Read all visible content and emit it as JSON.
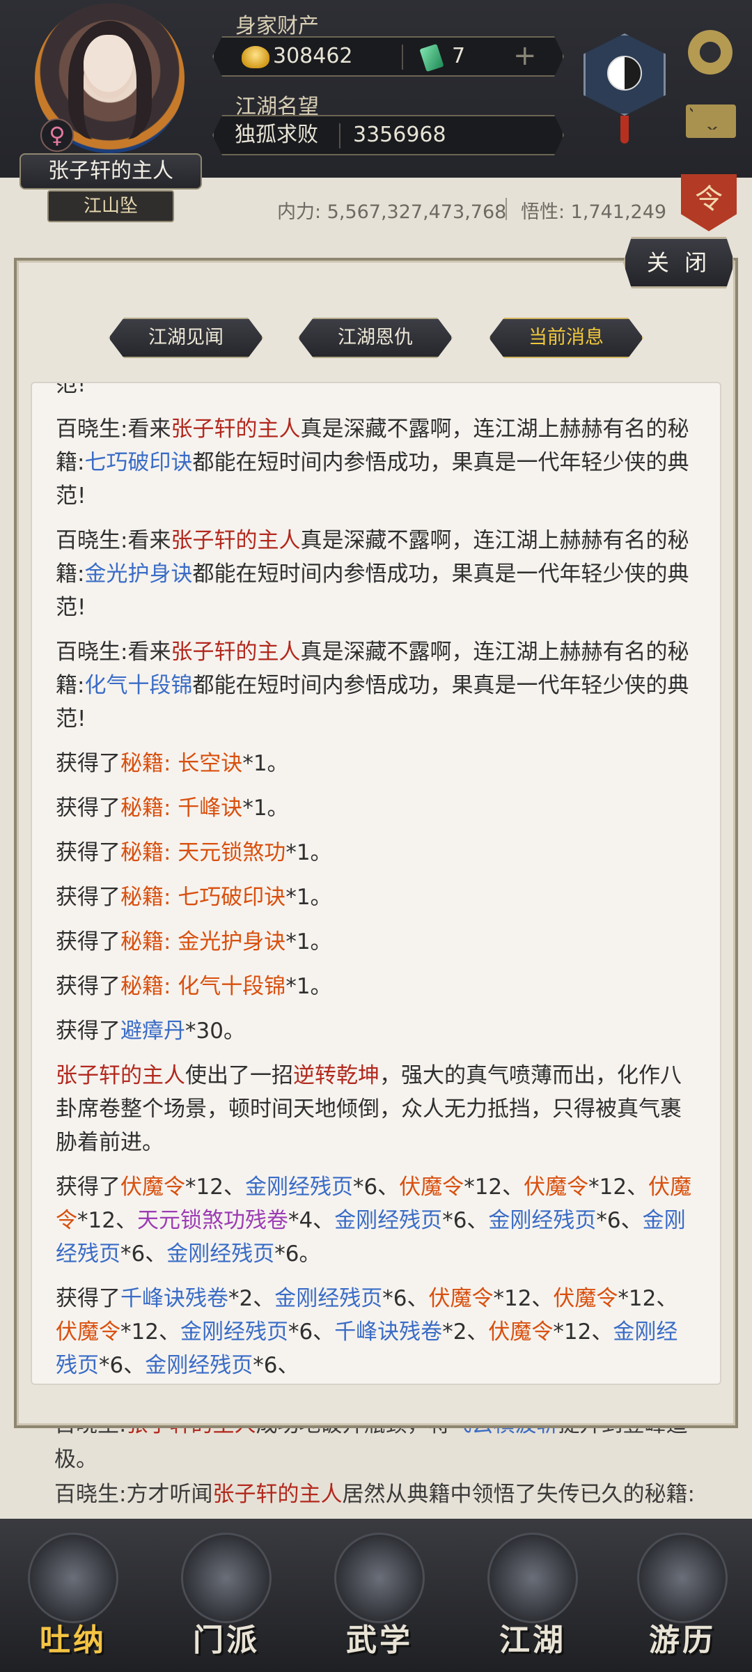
{
  "header": {
    "wealth_label": "身家财产",
    "silver": "308462",
    "jade": "7",
    "reputation_label": "江湖名望",
    "rank": "独孤求败",
    "reputation": "3356968",
    "gender_symbol": "♀",
    "player_name": "张子轩的主人",
    "title": "江山坠",
    "stats_neili": "内力: 5,567,327,473,768",
    "stats_wuxing": "悟性: 1,741,249",
    "order_badge": "令",
    "icons": [
      "coin-icon",
      "jade-icon",
      "plus-icon",
      "taiji-icon",
      "gear-icon",
      "mail-icon"
    ]
  },
  "panel": {
    "close_label": "关 闭",
    "tabs": [
      {
        "label": "江湖见闻",
        "active": false
      },
      {
        "label": "江湖恩仇",
        "active": false
      },
      {
        "label": "当前消息",
        "active": true
      }
    ]
  },
  "messages": {
    "m0_tail": "范!",
    "m1_a": "百晓生:看来",
    "m1_name": "张子轩的主人",
    "m1_b": "真是深藏不露啊，连江湖上赫赫有名的秘籍:",
    "m1_book": "七巧破印诀",
    "m1_c": "都能在短时间内参悟成功，果真是一代年轻少侠的典范!",
    "m2_a": "百晓生:看来",
    "m2_name": "张子轩的主人",
    "m2_b": "真是深藏不露啊，连江湖上赫赫有名的秘籍:",
    "m2_book": "金光护身诀",
    "m2_c": "都能在短时间内参悟成功，果真是一代年轻少侠的典范!",
    "m3_a": "百晓生:看来",
    "m3_name": "张子轩的主人",
    "m3_b": "真是深藏不露啊，连江湖上赫赫有名的秘籍:",
    "m3_book": "化气十段锦",
    "m3_c": "都能在短时间内参悟成功，果真是一代年轻少侠的典范!",
    "got": "获得了",
    "g1_item": "秘籍: 长空诀",
    "g2_item": "秘籍: 千峰诀",
    "g3_item": "秘籍: 天元锁煞功",
    "g4_item": "秘籍: 七巧破印诀",
    "g5_item": "秘籍: 金光护身诀",
    "g6_item": "秘籍: 化气十段锦",
    "x1": "*1。",
    "g7_item": "避瘴丹",
    "x30": "*30。",
    "s_name": "张子轩的主人",
    "s_a": "使出了一招",
    "s_skill": "逆转乾坤",
    "s_b": "，强大的真气喷薄而出，化作八卦席卷整个场景，顿时间天地倾倒，众人无力抵挡，只得被真气裹胁着前进。",
    "l1": {
      "fumo": "伏魔令",
      "jingang": "金刚经残页",
      "tianyuan": "天元锁煞功残卷",
      "x12": "*12、",
      "x6": "*6、",
      "x4": "*4、",
      "x6end": "*6。"
    },
    "l2": {
      "qianfeng": "千峰诀残卷",
      "x2": "*2、",
      "fumo": "伏魔令",
      "jingang": "金刚经残页",
      "x12": "*12、",
      "x6": "*6、"
    }
  },
  "background_log": {
    "line1_a": "百晓生:",
    "line1_name": "张子轩的主人",
    "line1_b": "成功地破开瓶颈，将",
    "line1_skill": "飞云横波斩",
    "line1_c": "提升到登峰造极。",
    "line2_a": "百晓生:方才听闻",
    "line2_name": "张子轩的主人",
    "line2_b": "居然从典籍中领悟了失传已久的秘籍:"
  },
  "nav": [
    {
      "label": "吐纳",
      "active": true
    },
    {
      "label": "门派",
      "active": false
    },
    {
      "label": "武学",
      "active": false
    },
    {
      "label": "江湖",
      "active": false
    },
    {
      "label": "游历",
      "active": false
    }
  ]
}
